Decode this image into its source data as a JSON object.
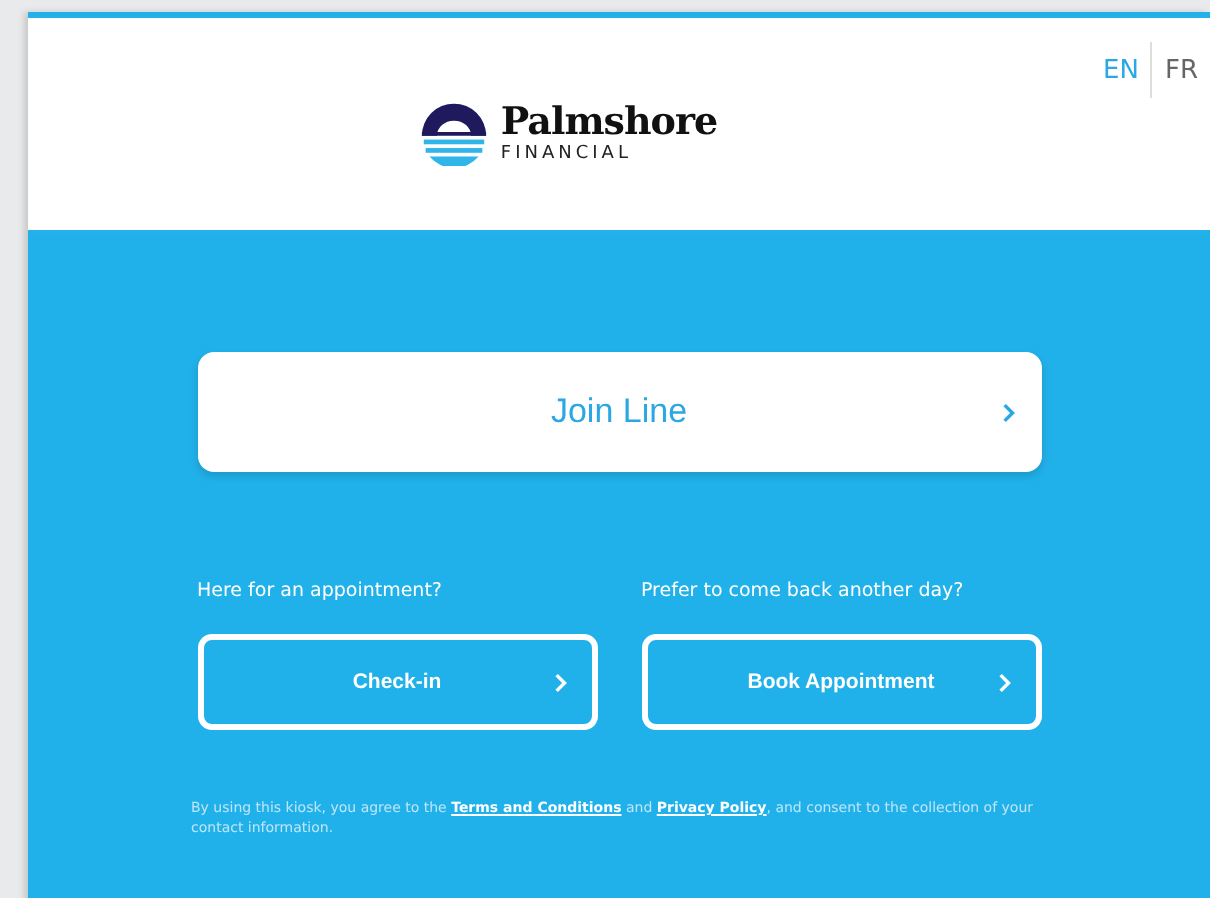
{
  "header": {
    "brand": "Palmshore",
    "tagline": "FINANCIAL",
    "languages": [
      {
        "label": "EN",
        "selected": true
      },
      {
        "label": "FR",
        "selected": false
      }
    ]
  },
  "primary_action": {
    "label": "Join Line"
  },
  "options": [
    {
      "prompt": "Here for an appointment?",
      "button": "Check-in"
    },
    {
      "prompt": "Prefer to come back another day?",
      "button": "Book Appointment"
    }
  ],
  "legal": [
    {
      "kind": "text",
      "text": "By using this kiosk, you agree to the "
    },
    {
      "kind": "link",
      "text": "Terms and Conditions"
    },
    {
      "kind": "text",
      "text": " and "
    },
    {
      "kind": "link",
      "text": "Privacy Policy"
    },
    {
      "kind": "text",
      "text": ", and consent to the collection of your contact information."
    }
  ]
}
